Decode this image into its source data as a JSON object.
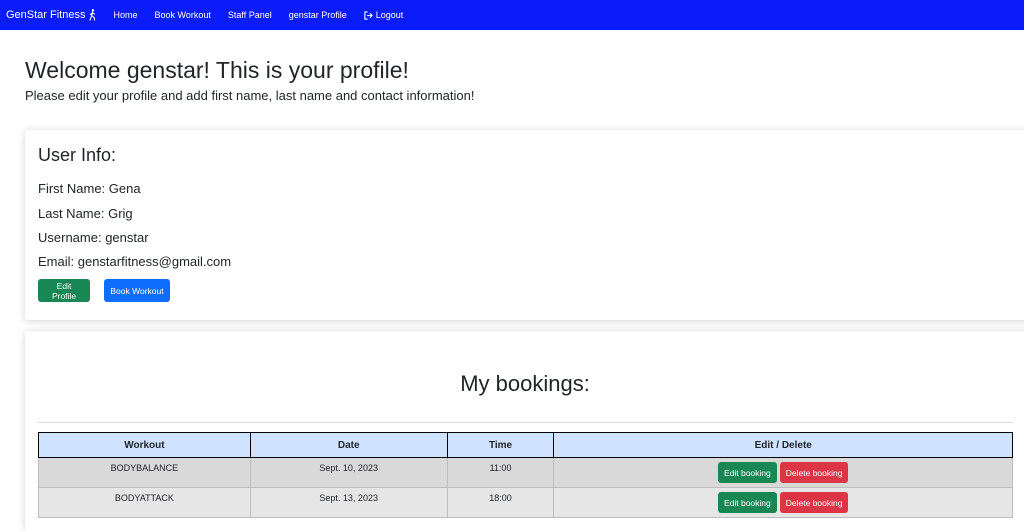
{
  "navbar": {
    "brand": "GenStar Fitness",
    "brand_icon": "person-walking-icon",
    "links": [
      "Home",
      "Book Workout",
      "Staff Panel",
      "genstar Profile"
    ],
    "logout": "Logout",
    "logout_icon": "logout-icon",
    "color": "#0b1cfb"
  },
  "header": {
    "welcome": "Welcome genstar! This is your profile!",
    "subtitle": "Please edit your profile and add first name, last name and contact information!"
  },
  "user_info": {
    "title": "User Info:",
    "first_name": "First Name: Gena",
    "last_name": "Last Name: Grig",
    "username": "Username: genstar",
    "email": "Email: genstarfitness@gmail.com",
    "edit_profile": "Edit Profile",
    "book_workout": "Book Workout"
  },
  "bookings": {
    "title": "My bookings:",
    "columns": [
      "Workout",
      "Date",
      "Time",
      "Edit / Delete"
    ],
    "rows": [
      {
        "workout": "BODYBALANCE",
        "date": "Sept. 10, 2023",
        "time": "11:00",
        "edit": "Edit booking",
        "delete": "Delete booking"
      },
      {
        "workout": "BODYATTACK",
        "date": "Sept. 13, 2023",
        "time": "18:00",
        "edit": "Edit booking",
        "delete": "Delete booking"
      }
    ]
  },
  "colors": {
    "green": "#198754",
    "blue": "#0d6efd",
    "red": "#dc3545",
    "header_bg": "#cfe2ff"
  }
}
